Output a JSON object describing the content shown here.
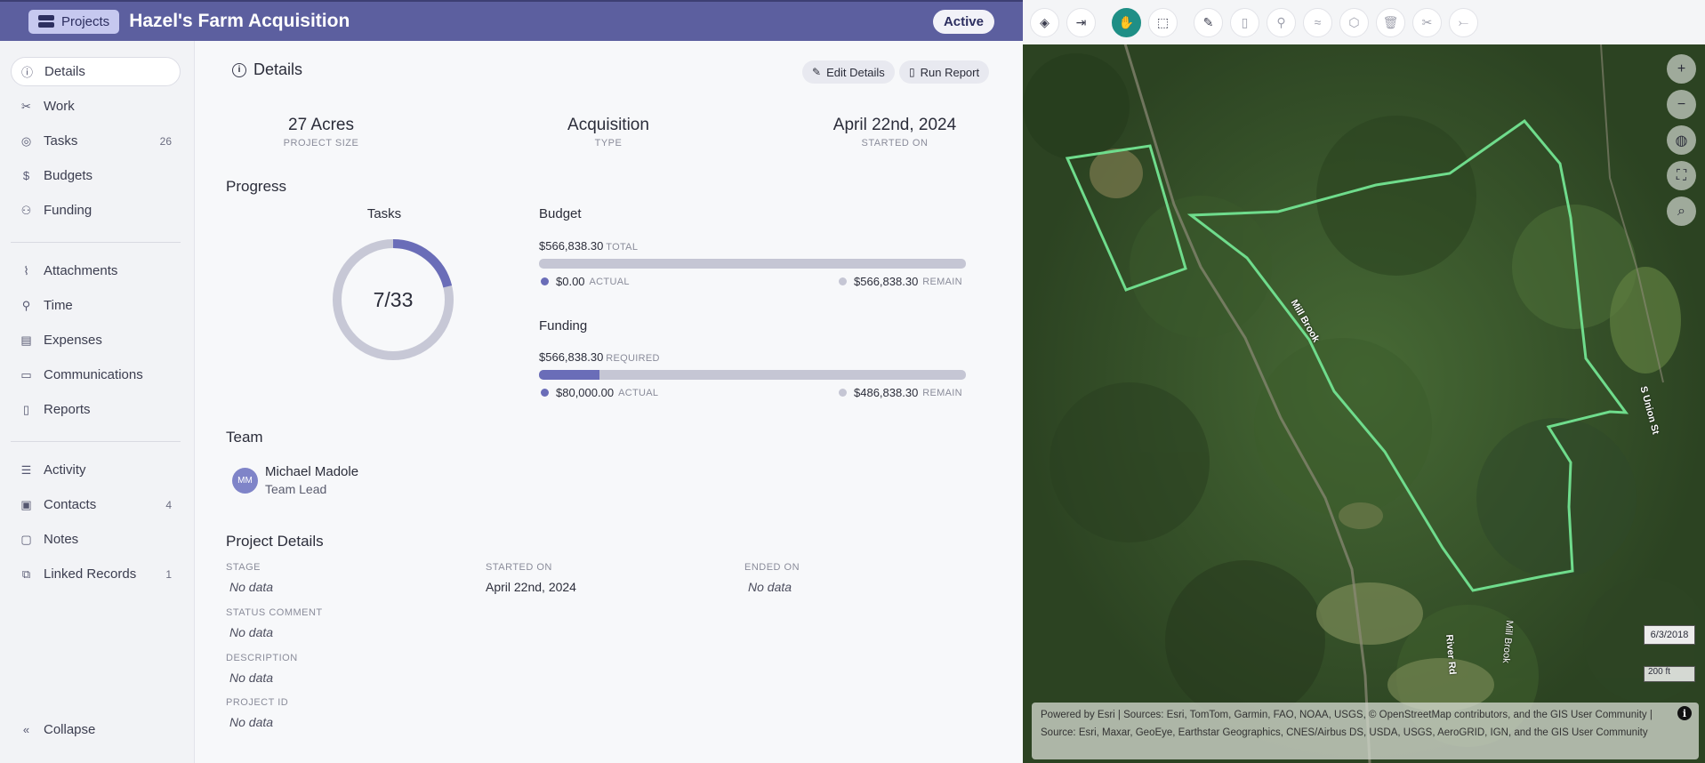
{
  "header": {
    "projects_label": "Projects",
    "title": "Hazel's Farm Acquisition",
    "status": "Active"
  },
  "sidebar": {
    "items": [
      {
        "label": "Details",
        "icon": "info-icon",
        "count": ""
      },
      {
        "label": "Work",
        "icon": "tools-icon",
        "count": ""
      },
      {
        "label": "Tasks",
        "icon": "check-circle-icon",
        "count": "26"
      },
      {
        "label": "Budgets",
        "icon": "dollar-icon",
        "count": ""
      },
      {
        "label": "Funding",
        "icon": "hand-coins-icon",
        "count": ""
      },
      {
        "label": "Attachments",
        "icon": "paperclip-icon",
        "count": ""
      },
      {
        "label": "Time",
        "icon": "user-clock-icon",
        "count": ""
      },
      {
        "label": "Expenses",
        "icon": "receipt-icon",
        "count": ""
      },
      {
        "label": "Communications",
        "icon": "chat-icon",
        "count": ""
      },
      {
        "label": "Reports",
        "icon": "document-icon",
        "count": ""
      },
      {
        "label": "Activity",
        "icon": "activity-list-icon",
        "count": ""
      },
      {
        "label": "Contacts",
        "icon": "contact-card-icon",
        "count": "4"
      },
      {
        "label": "Notes",
        "icon": "note-icon",
        "count": ""
      },
      {
        "label": "Linked Records",
        "icon": "linked-records-icon",
        "count": "1"
      }
    ],
    "collapse_label": "Collapse"
  },
  "details": {
    "heading": "Details",
    "edit_label": "Edit Details",
    "report_label": "Run Report",
    "stats": [
      {
        "value": "27 Acres",
        "label": "PROJECT SIZE"
      },
      {
        "value": "Acquisition",
        "label": "TYPE"
      },
      {
        "value": "April 22nd, 2024",
        "label": "STARTED ON"
      }
    ]
  },
  "progress": {
    "heading": "Progress",
    "tasks_title": "Tasks",
    "tasks_done": 7,
    "tasks_total": 33,
    "tasks_label": "7/33",
    "budget": {
      "title": "Budget",
      "total": "$566,838.30",
      "total_label": "TOTAL",
      "actual": "$0.00",
      "actual_label": "ACTUAL",
      "remain": "$566,838.30",
      "remain_label": "REMAIN",
      "fraction": 0
    },
    "funding": {
      "title": "Funding",
      "required": "$566,838.30",
      "required_label": "REQUIRED",
      "actual": "$80,000.00",
      "actual_label": "ACTUAL",
      "remain": "$486,838.30",
      "remain_label": "REMAIN",
      "fraction": 0.141
    }
  },
  "team": {
    "heading": "Team",
    "members": [
      {
        "initials": "MM",
        "name": "Michael Madole",
        "role": "Team Lead"
      }
    ]
  },
  "project_details": {
    "heading": "Project Details",
    "stage_label": "STAGE",
    "stage": "No data",
    "started_label": "STARTED ON",
    "started": "April 22nd, 2024",
    "ended_label": "ENDED ON",
    "ended": "No data",
    "status_comment_label": "STATUS COMMENT",
    "status_comment": "No data",
    "description_label": "DESCRIPTION",
    "description": "No data",
    "project_id_label": "PROJECT ID",
    "project_id": "No data"
  },
  "map": {
    "date": "6/3/2018",
    "scale": "200 ft",
    "roads": [
      "River Rd",
      "S Union St",
      "Mill Brook"
    ],
    "attribution": "Powered by Esri | Sources: Esri, TomTom, Garmin, FAO, NOAA, USGS, © OpenStreetMap contributors, and the GIS User Community | Source: Esri, Maxar, GeoEye, Earthstar Geographics, CNES/Airbus DS, USDA, USGS, AeroGRID, IGN, and the GIS User Community",
    "parcel_color": "#6fdc8c",
    "toolbar": [
      "layers-icon",
      "export-icon",
      "pan-hand-icon",
      "select-box-icon",
      "edit-icon",
      "add-file-icon",
      "pin-icon",
      "draw-line-icon",
      "draw-polygon-icon",
      "delete-icon",
      "cut-icon",
      "merge-icon"
    ],
    "controls": [
      "zoom-in-icon",
      "zoom-out-icon",
      "globe-icon",
      "fullscreen-icon",
      "search-icon"
    ]
  },
  "colors": {
    "header": "#5c5f9f",
    "accent": "#6a6db8",
    "active_tool": "#1f8f86"
  }
}
